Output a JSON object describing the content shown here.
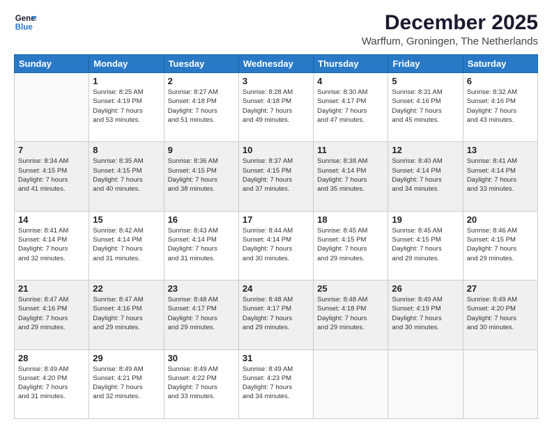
{
  "logo": {
    "line1": "General",
    "line2": "Blue"
  },
  "title": "December 2025",
  "location": "Warffum, Groningen, The Netherlands",
  "weekdays": [
    "Sunday",
    "Monday",
    "Tuesday",
    "Wednesday",
    "Thursday",
    "Friday",
    "Saturday"
  ],
  "weeks": [
    [
      {
        "day": "",
        "info": ""
      },
      {
        "day": "1",
        "info": "Sunrise: 8:25 AM\nSunset: 4:19 PM\nDaylight: 7 hours\nand 53 minutes."
      },
      {
        "day": "2",
        "info": "Sunrise: 8:27 AM\nSunset: 4:18 PM\nDaylight: 7 hours\nand 51 minutes."
      },
      {
        "day": "3",
        "info": "Sunrise: 8:28 AM\nSunset: 4:18 PM\nDaylight: 7 hours\nand 49 minutes."
      },
      {
        "day": "4",
        "info": "Sunrise: 8:30 AM\nSunset: 4:17 PM\nDaylight: 7 hours\nand 47 minutes."
      },
      {
        "day": "5",
        "info": "Sunrise: 8:31 AM\nSunset: 4:16 PM\nDaylight: 7 hours\nand 45 minutes."
      },
      {
        "day": "6",
        "info": "Sunrise: 8:32 AM\nSunset: 4:16 PM\nDaylight: 7 hours\nand 43 minutes."
      }
    ],
    [
      {
        "day": "7",
        "info": "Sunrise: 8:34 AM\nSunset: 4:15 PM\nDaylight: 7 hours\nand 41 minutes."
      },
      {
        "day": "8",
        "info": "Sunrise: 8:35 AM\nSunset: 4:15 PM\nDaylight: 7 hours\nand 40 minutes."
      },
      {
        "day": "9",
        "info": "Sunrise: 8:36 AM\nSunset: 4:15 PM\nDaylight: 7 hours\nand 38 minutes."
      },
      {
        "day": "10",
        "info": "Sunrise: 8:37 AM\nSunset: 4:15 PM\nDaylight: 7 hours\nand 37 minutes."
      },
      {
        "day": "11",
        "info": "Sunrise: 8:38 AM\nSunset: 4:14 PM\nDaylight: 7 hours\nand 35 minutes."
      },
      {
        "day": "12",
        "info": "Sunrise: 8:40 AM\nSunset: 4:14 PM\nDaylight: 7 hours\nand 34 minutes."
      },
      {
        "day": "13",
        "info": "Sunrise: 8:41 AM\nSunset: 4:14 PM\nDaylight: 7 hours\nand 33 minutes."
      }
    ],
    [
      {
        "day": "14",
        "info": "Sunrise: 8:41 AM\nSunset: 4:14 PM\nDaylight: 7 hours\nand 32 minutes."
      },
      {
        "day": "15",
        "info": "Sunrise: 8:42 AM\nSunset: 4:14 PM\nDaylight: 7 hours\nand 31 minutes."
      },
      {
        "day": "16",
        "info": "Sunrise: 8:43 AM\nSunset: 4:14 PM\nDaylight: 7 hours\nand 31 minutes."
      },
      {
        "day": "17",
        "info": "Sunrise: 8:44 AM\nSunset: 4:14 PM\nDaylight: 7 hours\nand 30 minutes."
      },
      {
        "day": "18",
        "info": "Sunrise: 8:45 AM\nSunset: 4:15 PM\nDaylight: 7 hours\nand 29 minutes."
      },
      {
        "day": "19",
        "info": "Sunrise: 8:45 AM\nSunset: 4:15 PM\nDaylight: 7 hours\nand 29 minutes."
      },
      {
        "day": "20",
        "info": "Sunrise: 8:46 AM\nSunset: 4:15 PM\nDaylight: 7 hours\nand 29 minutes."
      }
    ],
    [
      {
        "day": "21",
        "info": "Sunrise: 8:47 AM\nSunset: 4:16 PM\nDaylight: 7 hours\nand 29 minutes."
      },
      {
        "day": "22",
        "info": "Sunrise: 8:47 AM\nSunset: 4:16 PM\nDaylight: 7 hours\nand 29 minutes."
      },
      {
        "day": "23",
        "info": "Sunrise: 8:48 AM\nSunset: 4:17 PM\nDaylight: 7 hours\nand 29 minutes."
      },
      {
        "day": "24",
        "info": "Sunrise: 8:48 AM\nSunset: 4:17 PM\nDaylight: 7 hours\nand 29 minutes."
      },
      {
        "day": "25",
        "info": "Sunrise: 8:48 AM\nSunset: 4:18 PM\nDaylight: 7 hours\nand 29 minutes."
      },
      {
        "day": "26",
        "info": "Sunrise: 8:49 AM\nSunset: 4:19 PM\nDaylight: 7 hours\nand 30 minutes."
      },
      {
        "day": "27",
        "info": "Sunrise: 8:49 AM\nSunset: 4:20 PM\nDaylight: 7 hours\nand 30 minutes."
      }
    ],
    [
      {
        "day": "28",
        "info": "Sunrise: 8:49 AM\nSunset: 4:20 PM\nDaylight: 7 hours\nand 31 minutes."
      },
      {
        "day": "29",
        "info": "Sunrise: 8:49 AM\nSunset: 4:21 PM\nDaylight: 7 hours\nand 32 minutes."
      },
      {
        "day": "30",
        "info": "Sunrise: 8:49 AM\nSunset: 4:22 PM\nDaylight: 7 hours\nand 33 minutes."
      },
      {
        "day": "31",
        "info": "Sunrise: 8:49 AM\nSunset: 4:23 PM\nDaylight: 7 hours\nand 34 minutes."
      },
      {
        "day": "",
        "info": ""
      },
      {
        "day": "",
        "info": ""
      },
      {
        "day": "",
        "info": ""
      }
    ]
  ]
}
